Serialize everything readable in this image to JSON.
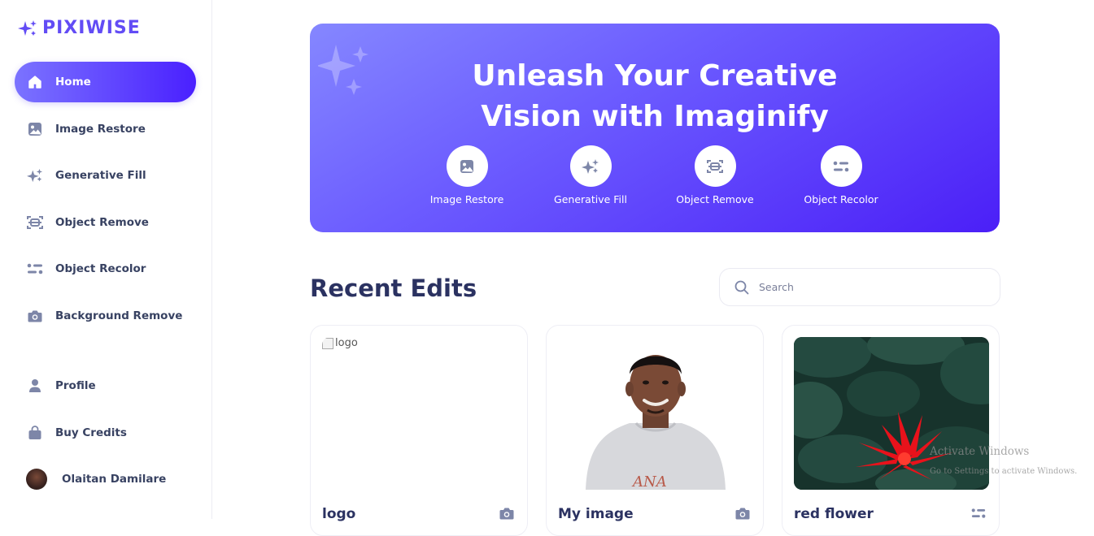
{
  "app": {
    "name": "PIXIWISE"
  },
  "sidebar": {
    "items": [
      {
        "label": "Home",
        "icon": "home-icon",
        "active": true
      },
      {
        "label": "Image Restore",
        "icon": "image-icon",
        "active": false
      },
      {
        "label": "Generative Fill",
        "icon": "sparkles-icon",
        "active": false
      },
      {
        "label": "Object Remove",
        "icon": "scan-icon",
        "active": false
      },
      {
        "label": "Object Recolor",
        "icon": "filter-icon",
        "active": false
      },
      {
        "label": "Background Remove",
        "icon": "camera-icon",
        "active": false
      }
    ],
    "bottom": [
      {
        "label": "Profile",
        "icon": "user-icon"
      },
      {
        "label": "Buy Credits",
        "icon": "bag-icon"
      }
    ],
    "user": {
      "name": "Olaitan Damilare"
    }
  },
  "banner": {
    "title_line1": "Unleash Your Creative",
    "title_line2": "Vision with Imaginify",
    "tools": [
      {
        "label": "Image Restore",
        "icon": "image-icon"
      },
      {
        "label": "Generative Fill",
        "icon": "sparkles-icon"
      },
      {
        "label": "Object Remove",
        "icon": "scan-icon"
      },
      {
        "label": "Object Recolor",
        "icon": "filter-icon"
      }
    ]
  },
  "recent": {
    "title": "Recent Edits",
    "search_placeholder": "Search",
    "cards": [
      {
        "title": "logo",
        "alt": "logo",
        "icon": "camera-icon"
      },
      {
        "title": "My image",
        "icon": "camera-icon"
      },
      {
        "title": "red flower",
        "icon": "filter-icon"
      }
    ]
  },
  "watermark": {
    "line1": "Activate Windows",
    "line2": "Go to Settings to activate Windows."
  },
  "colors": {
    "accent": "#624cf5",
    "sidebar_text": "#384262",
    "heading": "#2b3261"
  }
}
